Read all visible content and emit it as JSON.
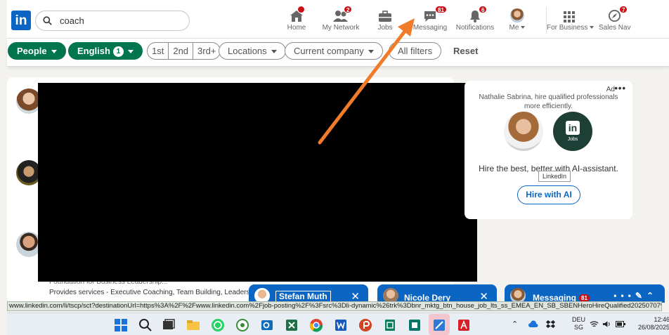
{
  "nav": {
    "logo": "in",
    "search_value": "coach",
    "items": [
      {
        "label": "Home",
        "badge": ""
      },
      {
        "label": "My Network",
        "badge": "2"
      },
      {
        "label": "Jobs",
        "badge": ""
      },
      {
        "label": "Messaging",
        "badge": "81"
      },
      {
        "label": "Notifications",
        "badge": "6"
      },
      {
        "label": "Me",
        "badge": ""
      },
      {
        "label": "For Business",
        "badge": ""
      },
      {
        "label": "Sales Nav",
        "badge": "7"
      }
    ]
  },
  "filters": {
    "people": "People",
    "english": "English",
    "english_count": "1",
    "degrees": [
      "1st",
      "2nd",
      "3rd+"
    ],
    "locations": "Locations",
    "current_company": "Current company",
    "all_filters": "All filters",
    "reset": "Reset"
  },
  "results": {
    "snippet_1": "Foundation for Business Leadership...",
    "snippet_2": "Provides services - Executive Coaching, Team Building, Leadership"
  },
  "ad": {
    "label": "Ad",
    "more": "•••",
    "text": "Nathalie Sabrina, hire qualified professionals more efficiently.",
    "jobs_logo": "in",
    "jobs_label": "Jobs",
    "headline": "Hire the best, better with AI-assistant.",
    "tooltip": "LinkedIn",
    "button": "Hire with AI"
  },
  "chats": {
    "chat1_name": "Stefan Muth",
    "chat2_name": "Nicole Dery",
    "messaging_label": "Messaging",
    "messaging_badge": "81",
    "close": "✕"
  },
  "status_url": "www.linkedin.com/li/tscp/sct?destinationUrl=https%3A%2F%2Fwww.linkedin.com%2Fjob-posting%2F%3Fsrc%3Dli-dynamic%26trk%3Dbnr_mktg_btn_house_job_lts_ss_EMEA_EN_SB_SBENHeroHireQualified20250707%253DLTS...",
  "taskbar": {
    "lang_1": "DEU",
    "lang_2": "SG",
    "time": "12:46",
    "date": "26/08/2025"
  },
  "colors": {
    "linkedin_blue": "#0a66c2",
    "filter_green": "#01754f",
    "badge_red": "#cc1016",
    "arrow_orange": "#f07c2a"
  }
}
